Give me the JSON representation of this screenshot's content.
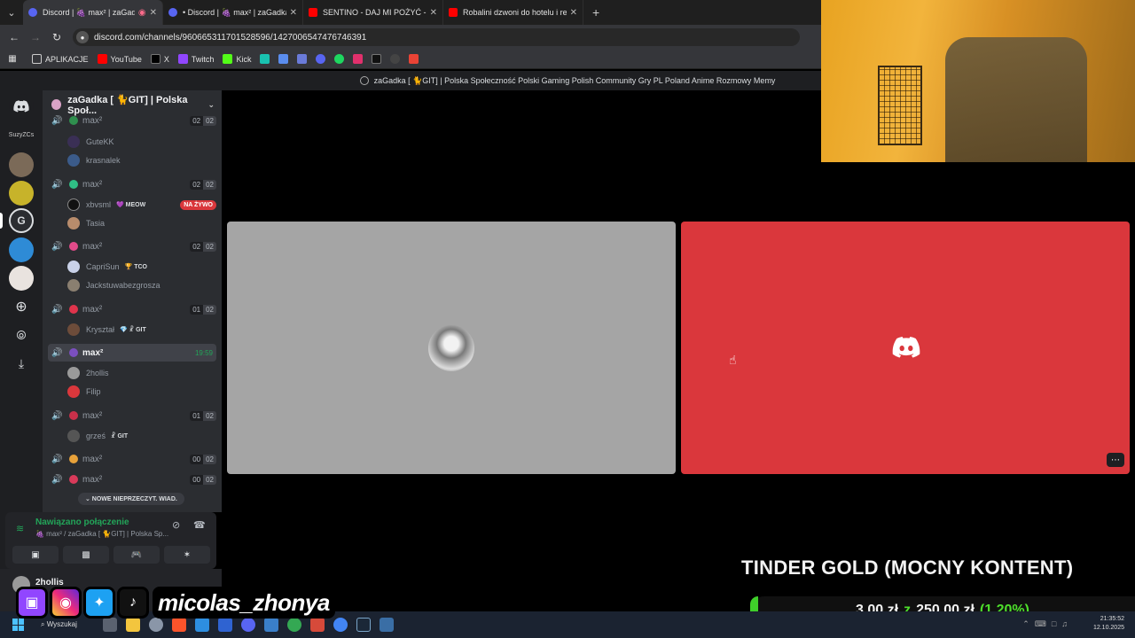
{
  "browser": {
    "tabs": [
      {
        "title": "Discord | 🍇 max² | zaGadk",
        "color": "#5865f2",
        "active": true
      },
      {
        "title": "• Discord | 🍇 max² | zaGadka",
        "color": "#5865f2",
        "active": false
      },
      {
        "title": "SENTINO - DAJ MI POŻYĆ - You",
        "color": "#ff0000",
        "active": false
      },
      {
        "title": "Robalini dzwoni do hotelu i rez",
        "color": "#ff0000",
        "active": false
      }
    ],
    "new_tab": "+",
    "url": "discord.com/channels/960665311701528596/1427006547476746391",
    "bookmarks": {
      "apps_label": "APLIKACJE",
      "youtube": "YouTube",
      "x": "X",
      "twitch": "Twitch",
      "kick": "Kick"
    }
  },
  "discord": {
    "window_title": "zaGadka [ 🐈GIT] | Polska Społeczność Polski Gaming Polish Community Gry PL Poland Anime Rozmowy Memy",
    "rail_label": "SuzyZCs",
    "server_name": "zaGadka [ 🐈GIT] | Polska Społ...",
    "channels": [
      {
        "name": "max²",
        "counts": [
          "02",
          "02"
        ],
        "users": [
          {
            "name": "GuteKK"
          },
          {
            "name": "krasnalek"
          }
        ]
      },
      {
        "name": "max²",
        "counts": [
          "02",
          "02"
        ],
        "users": [
          {
            "name": "xbvsml",
            "tag": "💜 MEOW",
            "live": "NA ŻYWO"
          },
          {
            "name": "Tasia"
          }
        ]
      },
      {
        "name": "max²",
        "counts": [
          "02",
          "02"
        ],
        "users": [
          {
            "name": "CapriSun",
            "tag": "🏆 TCO"
          },
          {
            "name": "Jackstuwabezgrosza"
          }
        ]
      },
      {
        "name": "max²",
        "counts": [
          "01",
          "02"
        ],
        "users": [
          {
            "name": "Kryształ",
            "tag": "💎 ☧ GIT"
          }
        ]
      },
      {
        "name": "max²",
        "time": "19:59",
        "selected": true,
        "users": [
          {
            "name": "2hollis"
          },
          {
            "name": "Filip"
          }
        ]
      },
      {
        "name": "max²",
        "counts": [
          "01",
          "02"
        ],
        "users": [
          {
            "name": "grześ",
            "tag": "☧ GIT"
          }
        ]
      },
      {
        "name": "max²",
        "counts": [
          "00",
          "02"
        ],
        "users": []
      },
      {
        "name": "max²",
        "counts": [
          "00",
          "02"
        ],
        "users": []
      }
    ],
    "unread_pill": "⌄ NOWE NIEPRZECZYT. WIAD.",
    "voice": {
      "status": "Nawiązano połączenie",
      "subtitle": "🍇 max² / zaGadka [ 🐈GIT] | Polska Sp..."
    },
    "current_user": "2hollis"
  },
  "overlay": {
    "tinder_title": "TINDER GOLD (MOCNY KONTENT)",
    "goal_current": "3,00 zł",
    "goal_sep": "z",
    "goal_target": "250,00 zł",
    "goal_percent": "(1.20%)",
    "goal_fraction": 0.012,
    "social_name": "micolas_zhonya"
  },
  "taskbar": {
    "search": "Wyszukaj",
    "time": "21:35:52",
    "date": "12.10.2025"
  },
  "colors": {
    "discord_red": "#da373c",
    "voice_green": "#23a559",
    "blurple": "#5865f2"
  }
}
